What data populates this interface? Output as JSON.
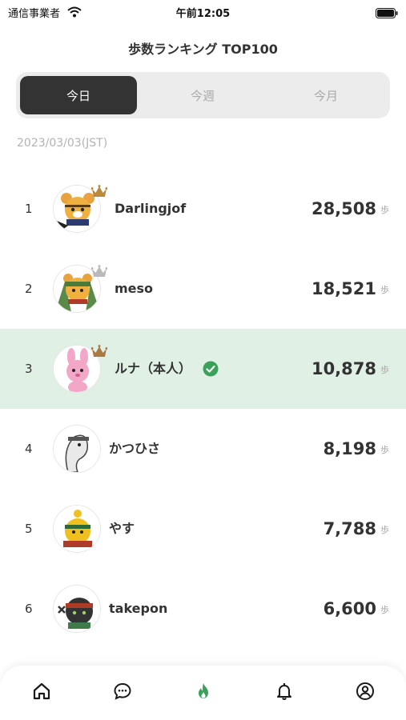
{
  "status_bar": {
    "carrier": "通信事業者",
    "time": "午前12:05"
  },
  "header": {
    "title": "歩数ランキング TOP100"
  },
  "period_tabs": [
    {
      "label": "今日",
      "active": true
    },
    {
      "label": "今週",
      "active": false
    },
    {
      "label": "今月",
      "active": false
    }
  ],
  "date": "2023/03/03(JST)",
  "step_unit": "歩",
  "rankings": [
    {
      "rank": "1",
      "name": "Darlingjof",
      "steps": "28,508",
      "crown": "gold"
    },
    {
      "rank": "2",
      "name": "meso",
      "steps": "18,521",
      "crown": "silver"
    },
    {
      "rank": "3",
      "name": "ルナ（本人）",
      "steps": "10,878",
      "crown": "bronze",
      "is_me": true,
      "verified": true
    },
    {
      "rank": "4",
      "name": "かつひさ",
      "steps": "8,198"
    },
    {
      "rank": "5",
      "name": "やす",
      "steps": "7,788"
    },
    {
      "rank": "6",
      "name": "takepon",
      "steps": "6,600"
    }
  ],
  "colors": {
    "accent_green": "#3aa15a",
    "highlight_row": "#e1f0e4",
    "active_tab": "#333333",
    "crown_gold": "#b88a3e",
    "crown_silver": "#b9b9b9",
    "crown_bronze": "#a87a45"
  },
  "bottom_nav": [
    {
      "icon": "home-icon",
      "active": false
    },
    {
      "icon": "chat-icon",
      "active": false
    },
    {
      "icon": "flame-icon",
      "active": true
    },
    {
      "icon": "bell-icon",
      "active": false
    },
    {
      "icon": "profile-icon",
      "active": false
    }
  ]
}
